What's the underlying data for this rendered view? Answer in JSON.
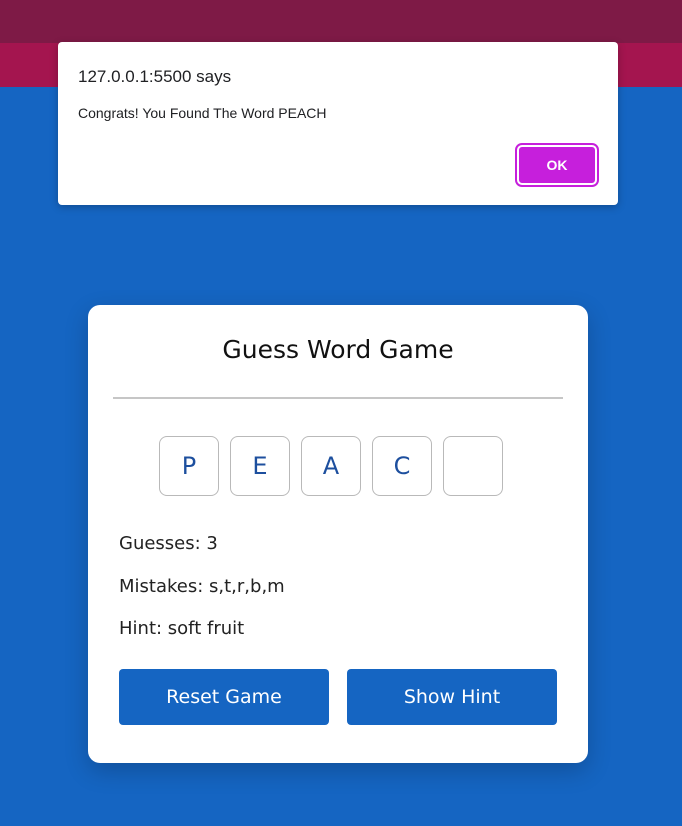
{
  "alert": {
    "title": "127.0.0.1:5500 says",
    "message": "Congrats! You Found The Word PEACH",
    "ok_label": "OK"
  },
  "game": {
    "title": "Guess Word Game",
    "letters": [
      "P",
      "E",
      "A",
      "C",
      ""
    ],
    "guesses_label": "Guesses: 3",
    "mistakes_label": "Mistakes: s,t,r,b,m",
    "hint_label": "Hint: soft fruit",
    "reset_label": "Reset Game",
    "show_hint_label": "Show Hint"
  },
  "colors": {
    "background": "#1565c2",
    "accent_button": "#1565c2",
    "alert_ok": "#c61fdc",
    "top_bar": "#7e1a46",
    "top_strip": "#a4154f"
  }
}
